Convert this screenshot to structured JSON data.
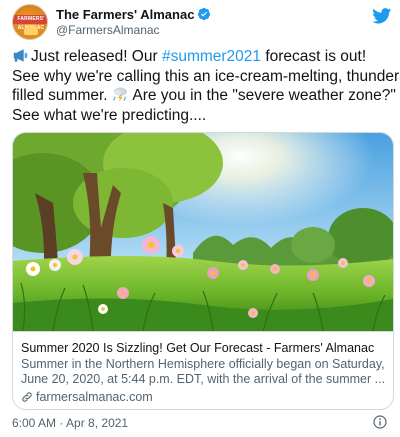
{
  "author": {
    "display_name": "The Farmers' Almanac",
    "handle": "@FarmersAlmanac",
    "avatar_text": "FARMERS' ALMANAC",
    "verified": true
  },
  "tweet": {
    "line1_before": "Just released! Our ",
    "hashtag": "#summer2021",
    "line1_after": " forecast is out!",
    "line2": "See why we're calling this an ice-cream-melting, thunder-",
    "line3_before": "filled summer. ",
    "line3_after": " Are you in the \"severe weather zone?\"",
    "line4": "See what we're predicting...."
  },
  "card": {
    "title": "Summer 2020 Is Sizzling! Get Our Forecast - Farmers' Almanac",
    "description_lines": [
      "Summer in the Northern Hemisphere officially began on Saturday,",
      "June 20, 2020, at 5:44 p.m. EDT, with the arrival of the summer ..."
    ],
    "domain": "farmersalmanac.com"
  },
  "meta": {
    "time": "6:00 AM",
    "separator": " · ",
    "date": "Apr 8, 2021"
  },
  "colors": {
    "link_blue": "#1d9bf0",
    "secondary_text": "#536471",
    "border": "#cfd9de",
    "twitter_blue": "#1d9bf0"
  },
  "icons": [
    "verified-badge-icon",
    "twitter-bird-icon",
    "megaphone-icon",
    "thunderstorm-icon",
    "link-icon",
    "info-icon"
  ]
}
